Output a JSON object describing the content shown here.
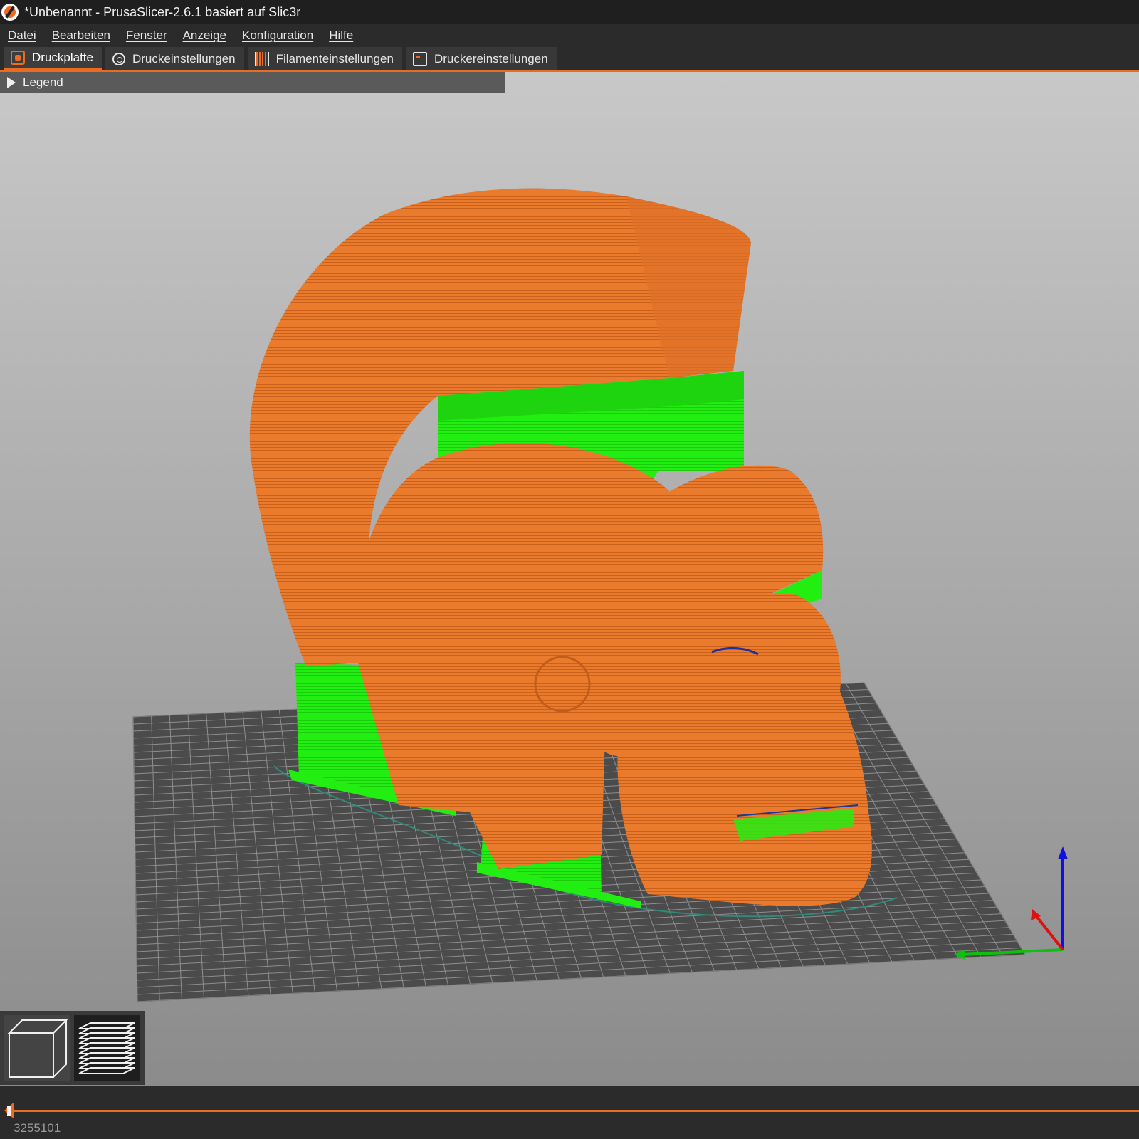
{
  "window": {
    "title": "*Unbenannt - PrusaSlicer-2.6.1 basiert auf Slic3r"
  },
  "menu": {
    "items": [
      {
        "label": "Datei"
      },
      {
        "label": "Bearbeiten"
      },
      {
        "label": "Fenster"
      },
      {
        "label": "Anzeige"
      },
      {
        "label": "Konfiguration"
      },
      {
        "label": "Hilfe"
      }
    ]
  },
  "tabs": {
    "items": [
      {
        "label": "Druckplatte",
        "icon": "plater-icon",
        "active": true
      },
      {
        "label": "Druckeinstellungen",
        "icon": "gear-icon",
        "active": false
      },
      {
        "label": "Filamenteinstellungen",
        "icon": "filament-icon",
        "active": false
      },
      {
        "label": "Druckereinstellungen",
        "icon": "printer-icon",
        "active": false
      }
    ]
  },
  "legend": {
    "label": "Legend",
    "collapsed": true
  },
  "viewport": {
    "object_colors": {
      "perimeter": "#ed7a2a",
      "support": "#22ee11",
      "bed": "#4a4a4a",
      "bed_grid": "#9a9a9a"
    },
    "axes_colors": {
      "x": "#e01010",
      "y": "#10c010",
      "z": "#1010e0"
    }
  },
  "view_buttons": {
    "items": [
      {
        "icon": "3d-view-cube-icon",
        "active": false
      },
      {
        "icon": "layers-preview-icon",
        "active": true
      }
    ]
  },
  "moves_slider": {
    "value": "3255101",
    "color": "#ed6b21"
  },
  "colors": {
    "accent": "#ed6b21",
    "titlebar": "#1f1f1f",
    "background": "#2b2b2b"
  }
}
